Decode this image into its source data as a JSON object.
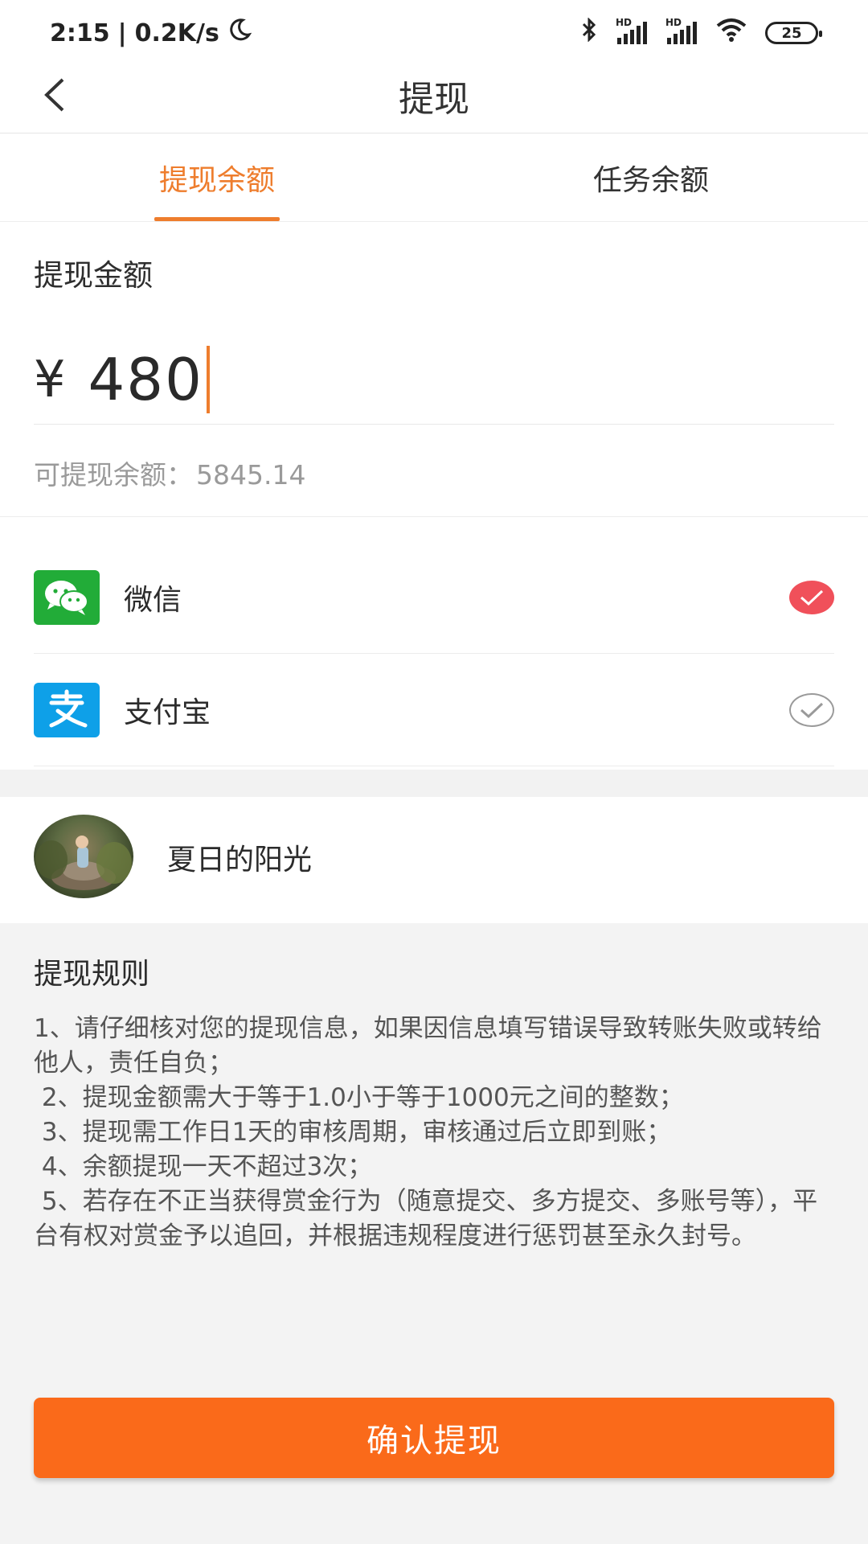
{
  "status_bar": {
    "time": "2:15",
    "speed": "0.2K/s",
    "battery": "25",
    "hd1": "HD",
    "hd2": "HD"
  },
  "nav": {
    "title": "提现"
  },
  "tabs": [
    {
      "label": "提现余额",
      "active": true
    },
    {
      "label": "任务余额",
      "active": false
    }
  ],
  "amount": {
    "label": "提现金额",
    "currency_symbol": "¥",
    "value": "480",
    "balance_label": "可提现余额：",
    "balance_value": "5845.14"
  },
  "payment_methods": [
    {
      "name": "微信",
      "icon": "wechat-icon",
      "selected": true
    },
    {
      "name": "支付宝",
      "icon": "alipay-icon",
      "selected": false
    }
  ],
  "user": {
    "name": "夏日的阳光"
  },
  "rules": {
    "title": "提现规则",
    "lines": [
      "1、请仔细核对您的提现信息，如果因信息填写错误导致转账失败或转给他人，责任自负；",
      " 2、提现金额需大于等于1.0小于等于1000元之间的整数；",
      " 3、提现需工作日1天的审核周期，审核通过后立即到账；",
      " 4、余额提现一天不超过3次；",
      " 5、若存在不正当获得赏金行为（随意提交、多方提交、多账号等），平台有权对赏金予以追回，并根据违规程度进行惩罚甚至永久封号。"
    ]
  },
  "confirm_button": {
    "label": "确认提现"
  },
  "colors": {
    "accent": "#ee7d2d",
    "button": "#fa6a1a",
    "check_on": "#f0505a",
    "wechat": "#22ac38",
    "alipay": "#0ea0e8"
  }
}
